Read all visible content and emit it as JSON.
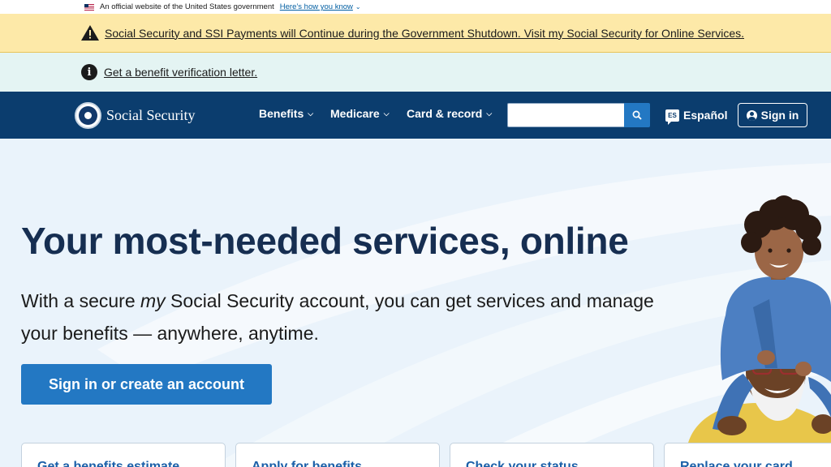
{
  "gov_banner": {
    "text": "An official website of the United States government",
    "link": "Here’s how you know"
  },
  "alert": {
    "text": "Social Security and SSI Payments will Continue during the Government Shutdown. Visit my Social Security for Online Services."
  },
  "info": {
    "text": "Get a benefit verification letter."
  },
  "header": {
    "logo_text": "Social Security",
    "nav": [
      {
        "label": "Benefits"
      },
      {
        "label": "Medicare"
      },
      {
        "label": "Card & record"
      }
    ],
    "search": {
      "value": "",
      "placeholder": ""
    },
    "language": {
      "badge": "ES",
      "label": "Español"
    },
    "signin_label": "Sign in"
  },
  "hero": {
    "title": "Your most-needed services, online",
    "subtitle_pre": "With a secure ",
    "subtitle_em": "my",
    "subtitle_post": " Social Security account, you can get services and manage your benefits — anywhere, anytime.",
    "cta_label": "Sign in or create an account"
  },
  "cards": [
    {
      "label": "Get a benefits estimate"
    },
    {
      "label": "Apply for benefits"
    },
    {
      "label": "Check your status"
    },
    {
      "label": "Replace your card"
    }
  ],
  "colors": {
    "header_bg": "#0b3d6e",
    "alert_bg": "#fde9a8",
    "info_bg": "#e4f4f3",
    "primary_button": "#2378c3",
    "hero_title": "#162e51"
  }
}
